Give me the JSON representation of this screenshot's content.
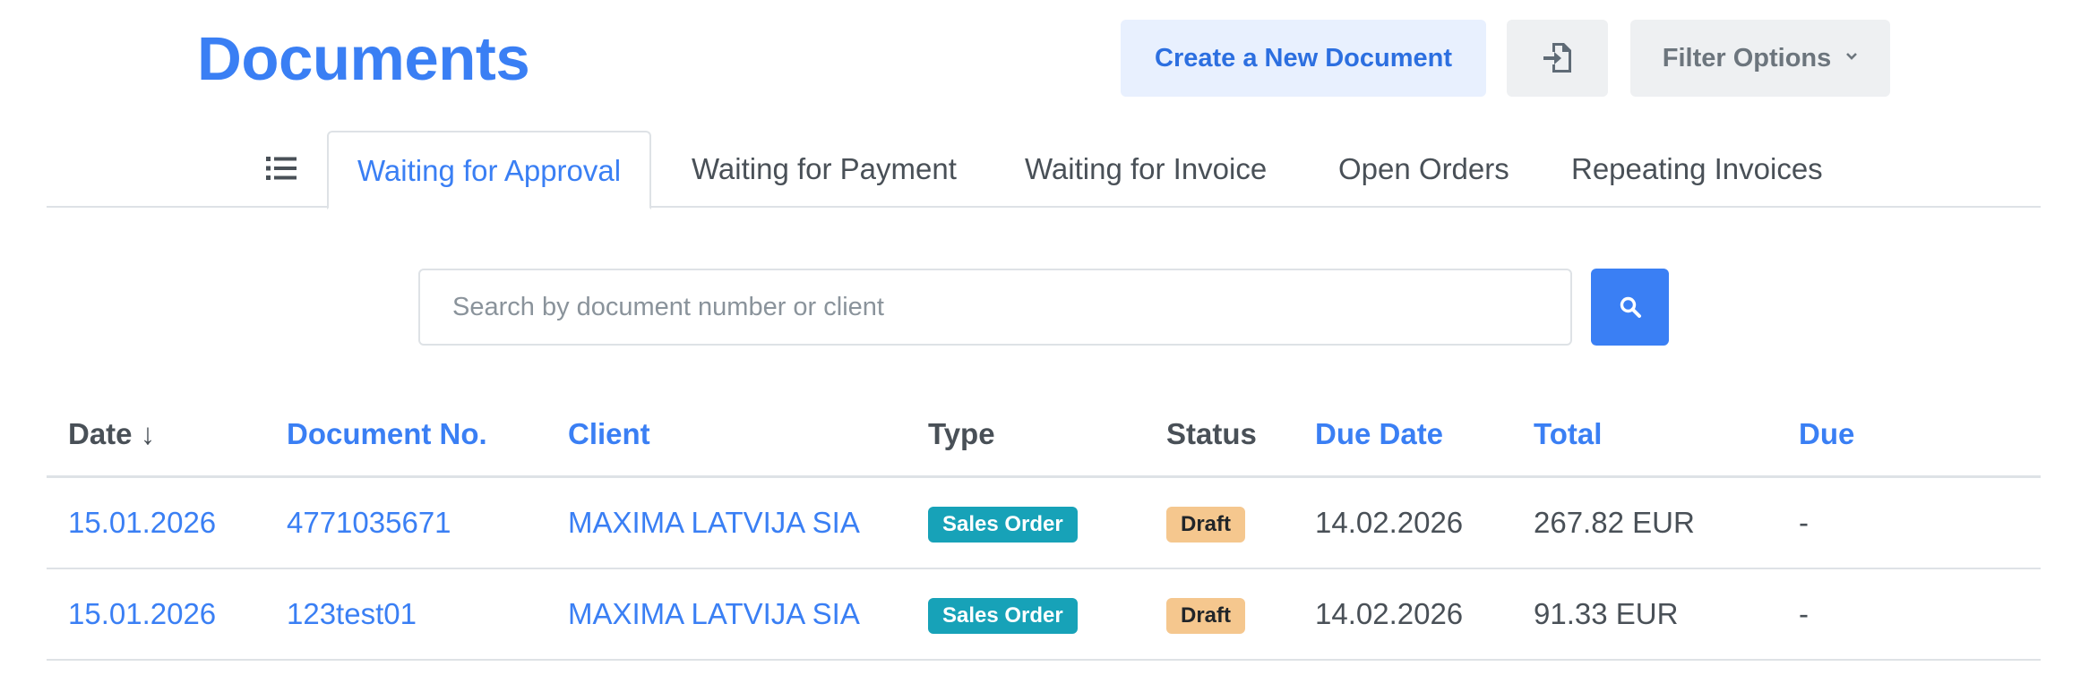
{
  "header": {
    "title": "Documents",
    "create_label": "Create a New Document",
    "import_icon": "file-import-icon",
    "filter_label": "Filter Options",
    "filter_chevron": "chevron-down-icon"
  },
  "tabs": {
    "list_icon": "list-icon",
    "items": [
      {
        "label": "Waiting for Approval",
        "active": true
      },
      {
        "label": "Waiting for Payment",
        "active": false
      },
      {
        "label": "Waiting for Invoice",
        "active": false
      },
      {
        "label": "Open Orders",
        "active": false
      },
      {
        "label": "Repeating Invoices",
        "active": false
      }
    ]
  },
  "search": {
    "placeholder": "Search by document number or client",
    "value": "",
    "icon": "search-icon"
  },
  "table": {
    "columns": {
      "date": "Date ↓",
      "document_no": "Document No.",
      "client": "Client",
      "type": "Type",
      "status": "Status",
      "due_date": "Due Date",
      "total": "Total",
      "due": "Due"
    },
    "rows": [
      {
        "date": "15.01.2026",
        "document_no": "4771035671",
        "client": "MAXIMA LATVIJA SIA",
        "type": "Sales Order",
        "status": "Draft",
        "due_date": "14.02.2026",
        "total": "267.82 EUR",
        "due": "-"
      },
      {
        "date": "15.01.2026",
        "document_no": "123test01",
        "client": "MAXIMA LATVIJA SIA",
        "type": "Sales Order",
        "status": "Draft",
        "due_date": "14.02.2026",
        "total": "91.33 EUR",
        "due": "-"
      }
    ]
  },
  "colors": {
    "accent": "#3a7ff4",
    "type_badge": "#17a2b8",
    "status_badge": "#f5c78e"
  }
}
